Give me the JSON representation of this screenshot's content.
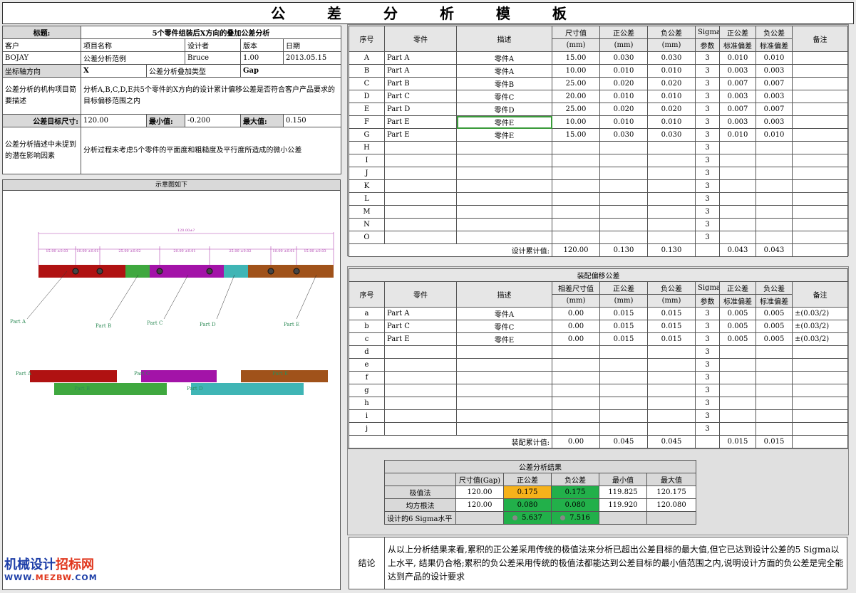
{
  "page_title": "公 差 分 析 模 板",
  "info": {
    "label_title": "标题:",
    "title_value": "5个零件组装后X方向的叠加公差分析",
    "hdr_customer": "客户",
    "hdr_project": "项目名称",
    "hdr_designer": "设计者",
    "hdr_version": "版本",
    "hdr_date": "日期",
    "customer": "BOJAY",
    "project": "公差分析范例",
    "designer": "Bruce",
    "version": "1.00",
    "date": "2013.05.15",
    "label_axis": "坐标轴方向",
    "axis_value": "X",
    "label_stack_type": "公差分析叠加类型",
    "stack_type_value": "Gap",
    "label_desc": "公差分析的机构项目简要描述",
    "desc_value": "分析A,B,C,D,E共5个零件的X方向的设计累计偏移公差是否符合客户产品要求的目标偏移范围之内",
    "label_target": "公差目标尺寸:",
    "target_value": "120.00",
    "label_min": "最小值:",
    "min_value": "-0.200",
    "label_max": "最大值:",
    "max_value": "0.150",
    "label_unconsidered": "公差分析描述中未提到的潜在影响因素",
    "unconsidered_value": "分析过程未考虑5个零件的平面度和粗糙度及平行度所造成的微小公差"
  },
  "diagram": {
    "header": "示意图如下",
    "total_dim": "120.00±?",
    "dims": [
      "15.00 ±0.03",
      "10.00 ±0.01",
      "25.00 ±0.02",
      "20.00 ±0.01",
      "25.00 ±0.02",
      "10.00 ±0.01",
      "15.00 ±0.03"
    ],
    "part_labels": [
      "Part A",
      "Part B",
      "Part C",
      "Part D",
      "Part E"
    ],
    "colors": {
      "part_a": "#b01212",
      "part_b": "#3fa83f",
      "part_c": "#a313a8",
      "part_d": "#3fb5b5",
      "part_e": "#a0521a",
      "dim": "#b040b0",
      "label": "#2e8b57"
    }
  },
  "table1": {
    "headers": {
      "no": "序号",
      "part": "零件",
      "desc": "描述",
      "size": "尺寸值",
      "size_unit": "(mm)",
      "pos": "正公差",
      "pos_unit": "(mm)",
      "neg": "负公差",
      "neg_unit": "(mm)",
      "sigma": "Sigma",
      "sigma2": "参数",
      "pos_sd": "正公差",
      "pos_sd2": "标准偏差",
      "neg_sd": "负公差",
      "neg_sd2": "标准偏差",
      "remark": "备注"
    },
    "rows": [
      {
        "no": "A",
        "part": "Part A",
        "desc": "零件A",
        "size": "15.00",
        "pos": "0.030",
        "neg": "0.030",
        "sigma": "3",
        "pos_sd": "0.010",
        "neg_sd": "0.010"
      },
      {
        "no": "B",
        "part": "Part A",
        "desc": "零件A",
        "size": "10.00",
        "pos": "0.010",
        "neg": "0.010",
        "sigma": "3",
        "pos_sd": "0.003",
        "neg_sd": "0.003"
      },
      {
        "no": "C",
        "part": "Part B",
        "desc": "零件B",
        "size": "25.00",
        "pos": "0.020",
        "neg": "0.020",
        "sigma": "3",
        "pos_sd": "0.007",
        "neg_sd": "0.007"
      },
      {
        "no": "D",
        "part": "Part C",
        "desc": "零件C",
        "size": "20.00",
        "pos": "0.010",
        "neg": "0.010",
        "sigma": "3",
        "pos_sd": "0.003",
        "neg_sd": "0.003"
      },
      {
        "no": "E",
        "part": "Part D",
        "desc": "零件D",
        "size": "25.00",
        "pos": "0.020",
        "neg": "0.020",
        "sigma": "3",
        "pos_sd": "0.007",
        "neg_sd": "0.007"
      },
      {
        "no": "F",
        "part": "Part E",
        "desc": "零件E",
        "size": "10.00",
        "pos": "0.010",
        "neg": "0.010",
        "sigma": "3",
        "pos_sd": "0.003",
        "neg_sd": "0.003"
      },
      {
        "no": "G",
        "part": "Part E",
        "desc": "零件E",
        "size": "15.00",
        "pos": "0.030",
        "neg": "0.030",
        "sigma": "3",
        "pos_sd": "0.010",
        "neg_sd": "0.010"
      },
      {
        "no": "H",
        "part": "",
        "desc": "",
        "size": "",
        "pos": "",
        "neg": "",
        "sigma": "3",
        "pos_sd": "",
        "neg_sd": ""
      },
      {
        "no": "I",
        "part": "",
        "desc": "",
        "size": "",
        "pos": "",
        "neg": "",
        "sigma": "3",
        "pos_sd": "",
        "neg_sd": ""
      },
      {
        "no": "J",
        "part": "",
        "desc": "",
        "size": "",
        "pos": "",
        "neg": "",
        "sigma": "3",
        "pos_sd": "",
        "neg_sd": ""
      },
      {
        "no": "K",
        "part": "",
        "desc": "",
        "size": "",
        "pos": "",
        "neg": "",
        "sigma": "3",
        "pos_sd": "",
        "neg_sd": ""
      },
      {
        "no": "L",
        "part": "",
        "desc": "",
        "size": "",
        "pos": "",
        "neg": "",
        "sigma": "3",
        "pos_sd": "",
        "neg_sd": ""
      },
      {
        "no": "M",
        "part": "",
        "desc": "",
        "size": "",
        "pos": "",
        "neg": "",
        "sigma": "3",
        "pos_sd": "",
        "neg_sd": ""
      },
      {
        "no": "N",
        "part": "",
        "desc": "",
        "size": "",
        "pos": "",
        "neg": "",
        "sigma": "3",
        "pos_sd": "",
        "neg_sd": ""
      },
      {
        "no": "O",
        "part": "",
        "desc": "",
        "size": "",
        "pos": "",
        "neg": "",
        "sigma": "3",
        "pos_sd": "",
        "neg_sd": ""
      }
    ],
    "total_label": "设计累计值:",
    "total": {
      "size": "120.00",
      "pos": "0.130",
      "neg": "0.130",
      "pos_sd": "0.043",
      "neg_sd": "0.043"
    }
  },
  "table2": {
    "title": "装配偏移公差",
    "headers": {
      "no": "序号",
      "part": "零件",
      "desc": "描述",
      "size": "相差尺寸值",
      "size_unit": "(mm)",
      "pos": "正公差",
      "pos_unit": "(mm)",
      "neg": "负公差",
      "neg_unit": "(mm)",
      "sigma": "Sigma",
      "sigma2": "参数",
      "pos_sd": "正公差",
      "pos_sd2": "标准偏差",
      "neg_sd": "负公差",
      "neg_sd2": "标准偏差",
      "remark": "备注"
    },
    "rows": [
      {
        "no": "a",
        "part": "Part A",
        "desc": "零件A",
        "size": "0.00",
        "pos": "0.015",
        "neg": "0.015",
        "sigma": "3",
        "pos_sd": "0.005",
        "neg_sd": "0.005",
        "remark": "±(0.03/2)"
      },
      {
        "no": "b",
        "part": "Part C",
        "desc": "零件C",
        "size": "0.00",
        "pos": "0.015",
        "neg": "0.015",
        "sigma": "3",
        "pos_sd": "0.005",
        "neg_sd": "0.005",
        "remark": "±(0.03/2)"
      },
      {
        "no": "c",
        "part": "Part E",
        "desc": "零件E",
        "size": "0.00",
        "pos": "0.015",
        "neg": "0.015",
        "sigma": "3",
        "pos_sd": "0.005",
        "neg_sd": "0.005",
        "remark": "±(0.03/2)"
      },
      {
        "no": "d",
        "part": "",
        "desc": "",
        "size": "",
        "pos": "",
        "neg": "",
        "sigma": "3",
        "pos_sd": "",
        "neg_sd": "",
        "remark": ""
      },
      {
        "no": "e",
        "part": "",
        "desc": "",
        "size": "",
        "pos": "",
        "neg": "",
        "sigma": "3",
        "pos_sd": "",
        "neg_sd": "",
        "remark": ""
      },
      {
        "no": "f",
        "part": "",
        "desc": "",
        "size": "",
        "pos": "",
        "neg": "",
        "sigma": "3",
        "pos_sd": "",
        "neg_sd": "",
        "remark": ""
      },
      {
        "no": "g",
        "part": "",
        "desc": "",
        "size": "",
        "pos": "",
        "neg": "",
        "sigma": "3",
        "pos_sd": "",
        "neg_sd": "",
        "remark": ""
      },
      {
        "no": "h",
        "part": "",
        "desc": "",
        "size": "",
        "pos": "",
        "neg": "",
        "sigma": "3",
        "pos_sd": "",
        "neg_sd": "",
        "remark": ""
      },
      {
        "no": "i",
        "part": "",
        "desc": "",
        "size": "",
        "pos": "",
        "neg": "",
        "sigma": "3",
        "pos_sd": "",
        "neg_sd": "",
        "remark": ""
      },
      {
        "no": "j",
        "part": "",
        "desc": "",
        "size": "",
        "pos": "",
        "neg": "",
        "sigma": "3",
        "pos_sd": "",
        "neg_sd": "",
        "remark": ""
      }
    ],
    "total_label": "装配累计值:",
    "total": {
      "size": "0.00",
      "pos": "0.045",
      "neg": "0.045",
      "pos_sd": "0.015",
      "neg_sd": "0.015"
    }
  },
  "result": {
    "title": "公差分析结果",
    "headers": {
      "size": "尺寸值(Gap)",
      "pos": "正公差",
      "neg": "负公差",
      "min": "最小值",
      "max": "最大值"
    },
    "worst": {
      "label": "极值法",
      "size": "120.00",
      "pos": "0.175",
      "neg": "0.175",
      "min": "119.825",
      "max": "120.175"
    },
    "rss": {
      "label": "均方根法",
      "size": "120.00",
      "pos": "0.080",
      "neg": "0.080",
      "min": "119.920",
      "max": "120.080"
    },
    "sigma": {
      "label": "设计的6 Sigma水平",
      "pos": "5.637",
      "neg": "7.516"
    },
    "colors": {
      "fail": "#f6b21b",
      "pass": "#22b04a"
    }
  },
  "conclusion": {
    "label": "结论",
    "text": "从以上分析结果来看,累积的正公差采用传统的极值法来分析已超出公差目标的最大值,但它已达到设计公差的5 Sigma以上水平, 结果仍合格;累积的负公差采用传统的极值法都能达到公差目标的最小值范围之内,说明设计方面的负公差是完全能达到产品的设计要求"
  },
  "watermark": {
    "line1_a": "机械设计",
    "line1_b": "招标网",
    "line2_a": "WWW.",
    "line2_b": "MEZBW",
    "line2_c": ".COM"
  }
}
